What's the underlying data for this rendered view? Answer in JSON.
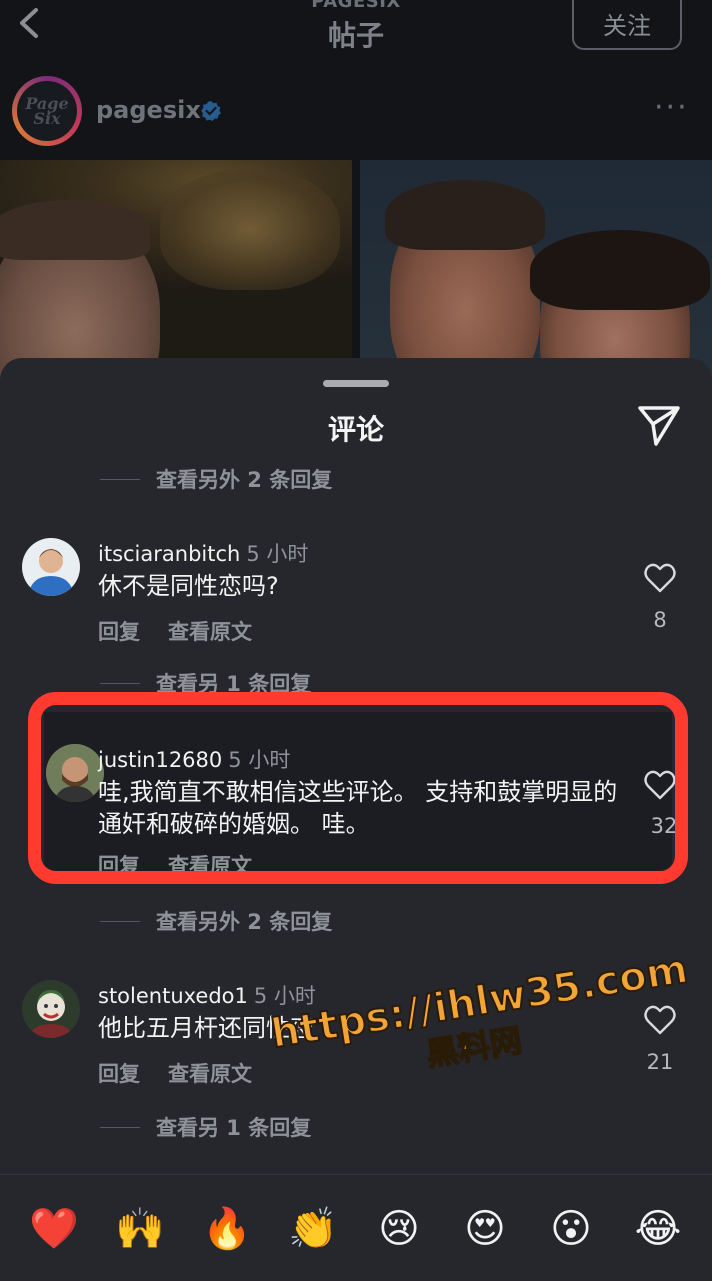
{
  "header": {
    "sup_title": "PAGESIX",
    "title": "帖子",
    "follow_label": "关注"
  },
  "account": {
    "logo_line1": "Page",
    "logo_line2": "Six",
    "name": "pagesix",
    "verified": true,
    "more": "···"
  },
  "sheet": {
    "title": "评论",
    "more_replies": [
      "查看另外 2 条回复",
      "查看另 1 条回复",
      "查看另外 2 条回复",
      "查看另 1 条回复"
    ]
  },
  "comments": [
    {
      "username": "itsciaranbitch",
      "time": "5 小时",
      "text": "休不是同性恋吗?",
      "reply_label": "回复",
      "translate_label": "查看原文",
      "likes": "8"
    },
    {
      "username": "justin12680",
      "time": "5 小时",
      "text": "哇,我简直不敢相信这些评论。 支持和鼓掌明显的通奸和破碎的婚姻。 哇。",
      "reply_label": "回复",
      "translate_label": "查看原文",
      "likes": "32"
    },
    {
      "username": "stolentuxedo1",
      "time": "5 小时",
      "text": "他比五月杆还同性恋",
      "reply_label": "回复",
      "translate_label": "查看原文",
      "likes": "21"
    }
  ],
  "watermark": {
    "url": "https://ihlw35.com",
    "sub": "黑料网"
  },
  "emoji_bar": [
    "❤️",
    "🙌",
    "🔥",
    "👏",
    "😢",
    "😍",
    "😮",
    "😂"
  ],
  "colors": {
    "background": "#121418",
    "sheet": "#25272d",
    "highlight": "#ff3b30",
    "watermark": "#f3a436",
    "verified": "#3897f0"
  }
}
